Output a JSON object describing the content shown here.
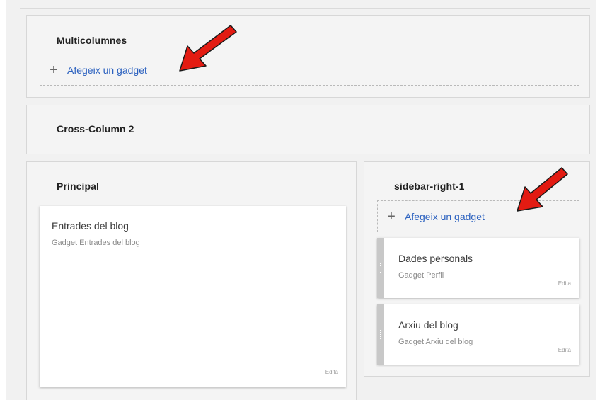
{
  "sections": {
    "multicolumns": {
      "title": "Multicolumnes",
      "add_gadget": {
        "icon": "plus-icon",
        "label": "Afegeix un gadget"
      }
    },
    "cross_column_2": {
      "title": "Cross-Column 2"
    },
    "principal": {
      "title": "Principal",
      "gadgets": [
        {
          "title": "Entrades del blog",
          "subtitle": "Gadget Entrades del blog",
          "edit": "Edita"
        }
      ]
    },
    "sidebar_right_1": {
      "title": "sidebar-right-1",
      "add_gadget": {
        "icon": "plus-icon",
        "label": "Afegeix un gadget"
      },
      "gadgets": [
        {
          "title": "Dades personals",
          "subtitle": "Gadget Perfil",
          "edit": "Edita"
        },
        {
          "title": "Arxiu del blog",
          "subtitle": "Gadget Arxiu del blog",
          "edit": "Edita"
        }
      ]
    }
  },
  "colors": {
    "link": "#2b61bf",
    "annotation_arrow": "#e31b12",
    "section_bg": "#f4f4f4",
    "page_bg": "#f1f1f1"
  }
}
